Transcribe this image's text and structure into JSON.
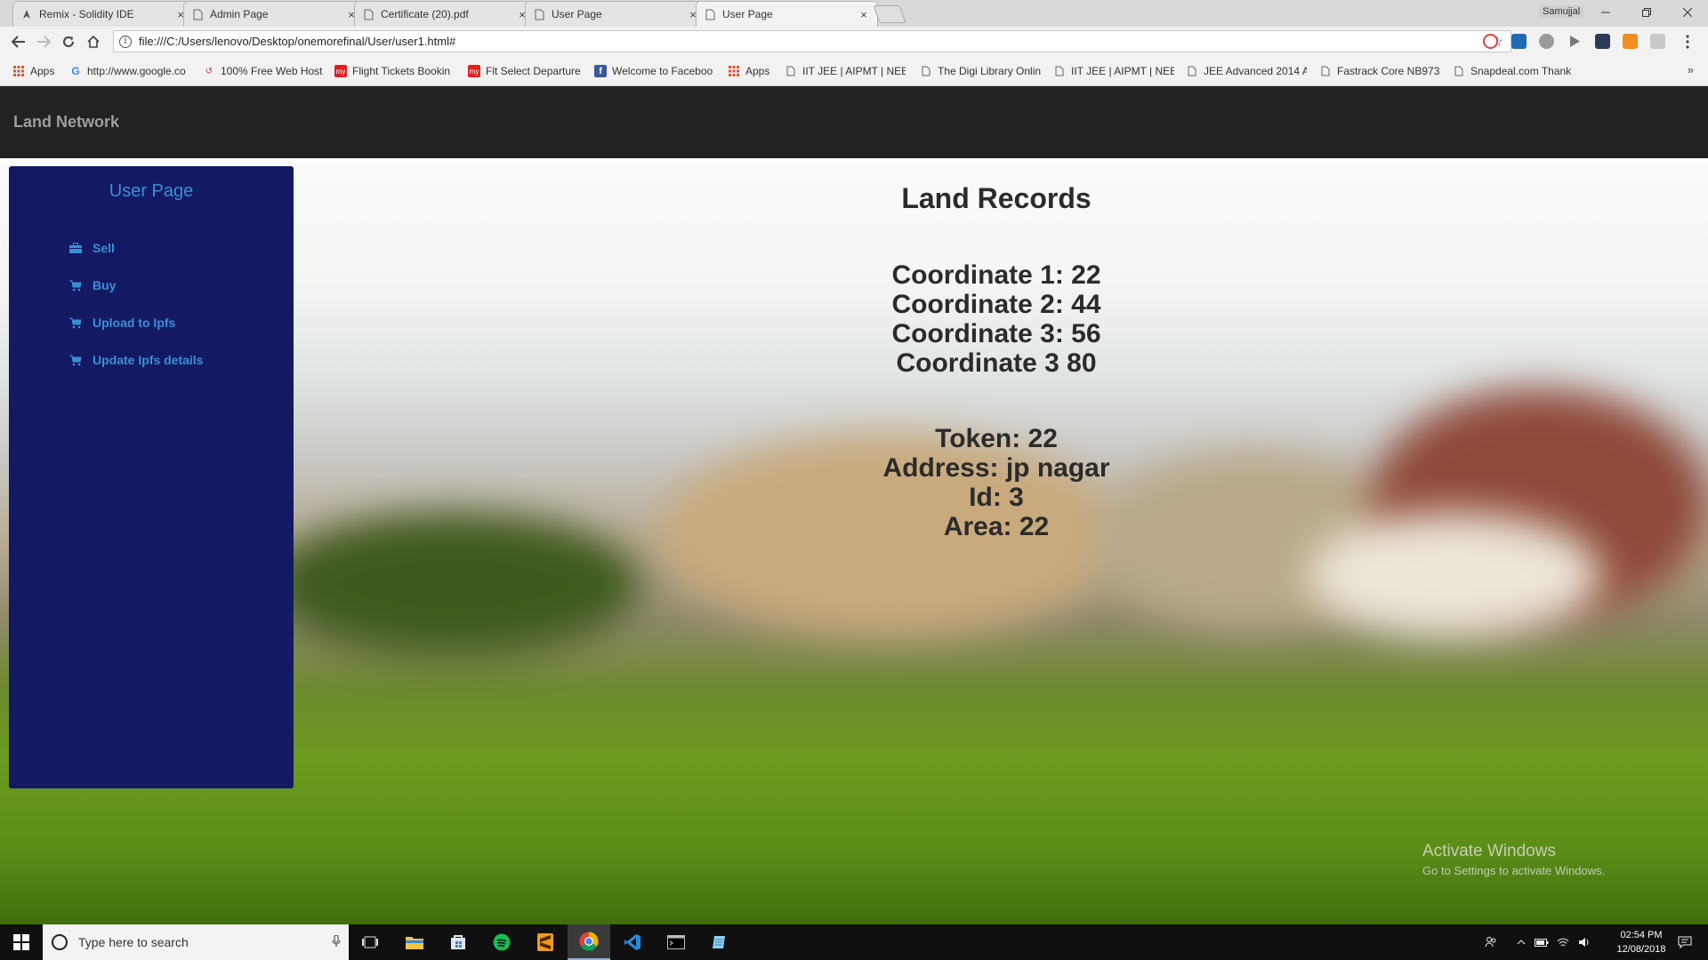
{
  "browser": {
    "tabs": [
      {
        "title": "Remix - Solidity IDE",
        "icon": "remix-icon"
      },
      {
        "title": "Admin Page",
        "icon": "page-icon"
      },
      {
        "title": "Certificate (20).pdf",
        "icon": "page-icon"
      },
      {
        "title": "User Page",
        "icon": "page-icon"
      },
      {
        "title": "User Page",
        "icon": "page-icon",
        "active": true
      }
    ],
    "tab_close_glyph": "×",
    "profile_name": "Samujjal",
    "url": "file:///C:/Users/lenovo/Desktop/onemorefinal/User/user1.html#",
    "bookmarks": [
      {
        "label": "Apps",
        "icon": "apps-grid-icon"
      },
      {
        "label": "http://www.google.co",
        "icon": "google-icon"
      },
      {
        "label": "100% Free Web Host",
        "icon": "webhost-icon"
      },
      {
        "label": "Flight Tickets Bookin",
        "icon": "makemytrip-icon"
      },
      {
        "label": "Flt Select Departure",
        "icon": "makemytrip-icon"
      },
      {
        "label": "Welcome to Faceboo",
        "icon": "facebook-icon"
      },
      {
        "label": "Apps",
        "icon": "apps-grid-icon"
      },
      {
        "label": "IIT JEE | AIPMT | NEET",
        "icon": "page-icon"
      },
      {
        "label": "The Digi Library Onlin",
        "icon": "page-icon"
      },
      {
        "label": "IIT JEE | AIPMT | NEET",
        "icon": "page-icon"
      },
      {
        "label": "JEE Advanced 2014 A",
        "icon": "page-icon"
      },
      {
        "label": "Fastrack Core NB973",
        "icon": "page-icon"
      },
      {
        "label": "Snapdeal.com Thank",
        "icon": "page-icon"
      }
    ],
    "more_glyph": "»"
  },
  "navbar": {
    "brand": "Land Network"
  },
  "sidebar": {
    "title": "User Page",
    "items": [
      {
        "label": "Sell",
        "icon": "briefcase-icon"
      },
      {
        "label": "Buy",
        "icon": "cart-icon"
      },
      {
        "label": "Upload to Ipfs",
        "icon": "cart-icon"
      },
      {
        "label": "Update Ipfs details",
        "icon": "cart-icon"
      }
    ]
  },
  "records": {
    "title": "Land Records",
    "coordinates": [
      "Coordinate 1: 22",
      "Coordinate 2: 44",
      "Coordinate 3: 56",
      "Coordinate 3 80"
    ],
    "details": [
      "Token: 22",
      "Address: jp nagar",
      "Id: 3",
      "Area: 22"
    ]
  },
  "watermark": {
    "title": "Activate Windows",
    "subtitle": "Go to Settings to activate Windows."
  },
  "taskbar": {
    "search_placeholder": "Type here to search",
    "time": "02:54 PM",
    "date": "12/08/2018"
  }
}
